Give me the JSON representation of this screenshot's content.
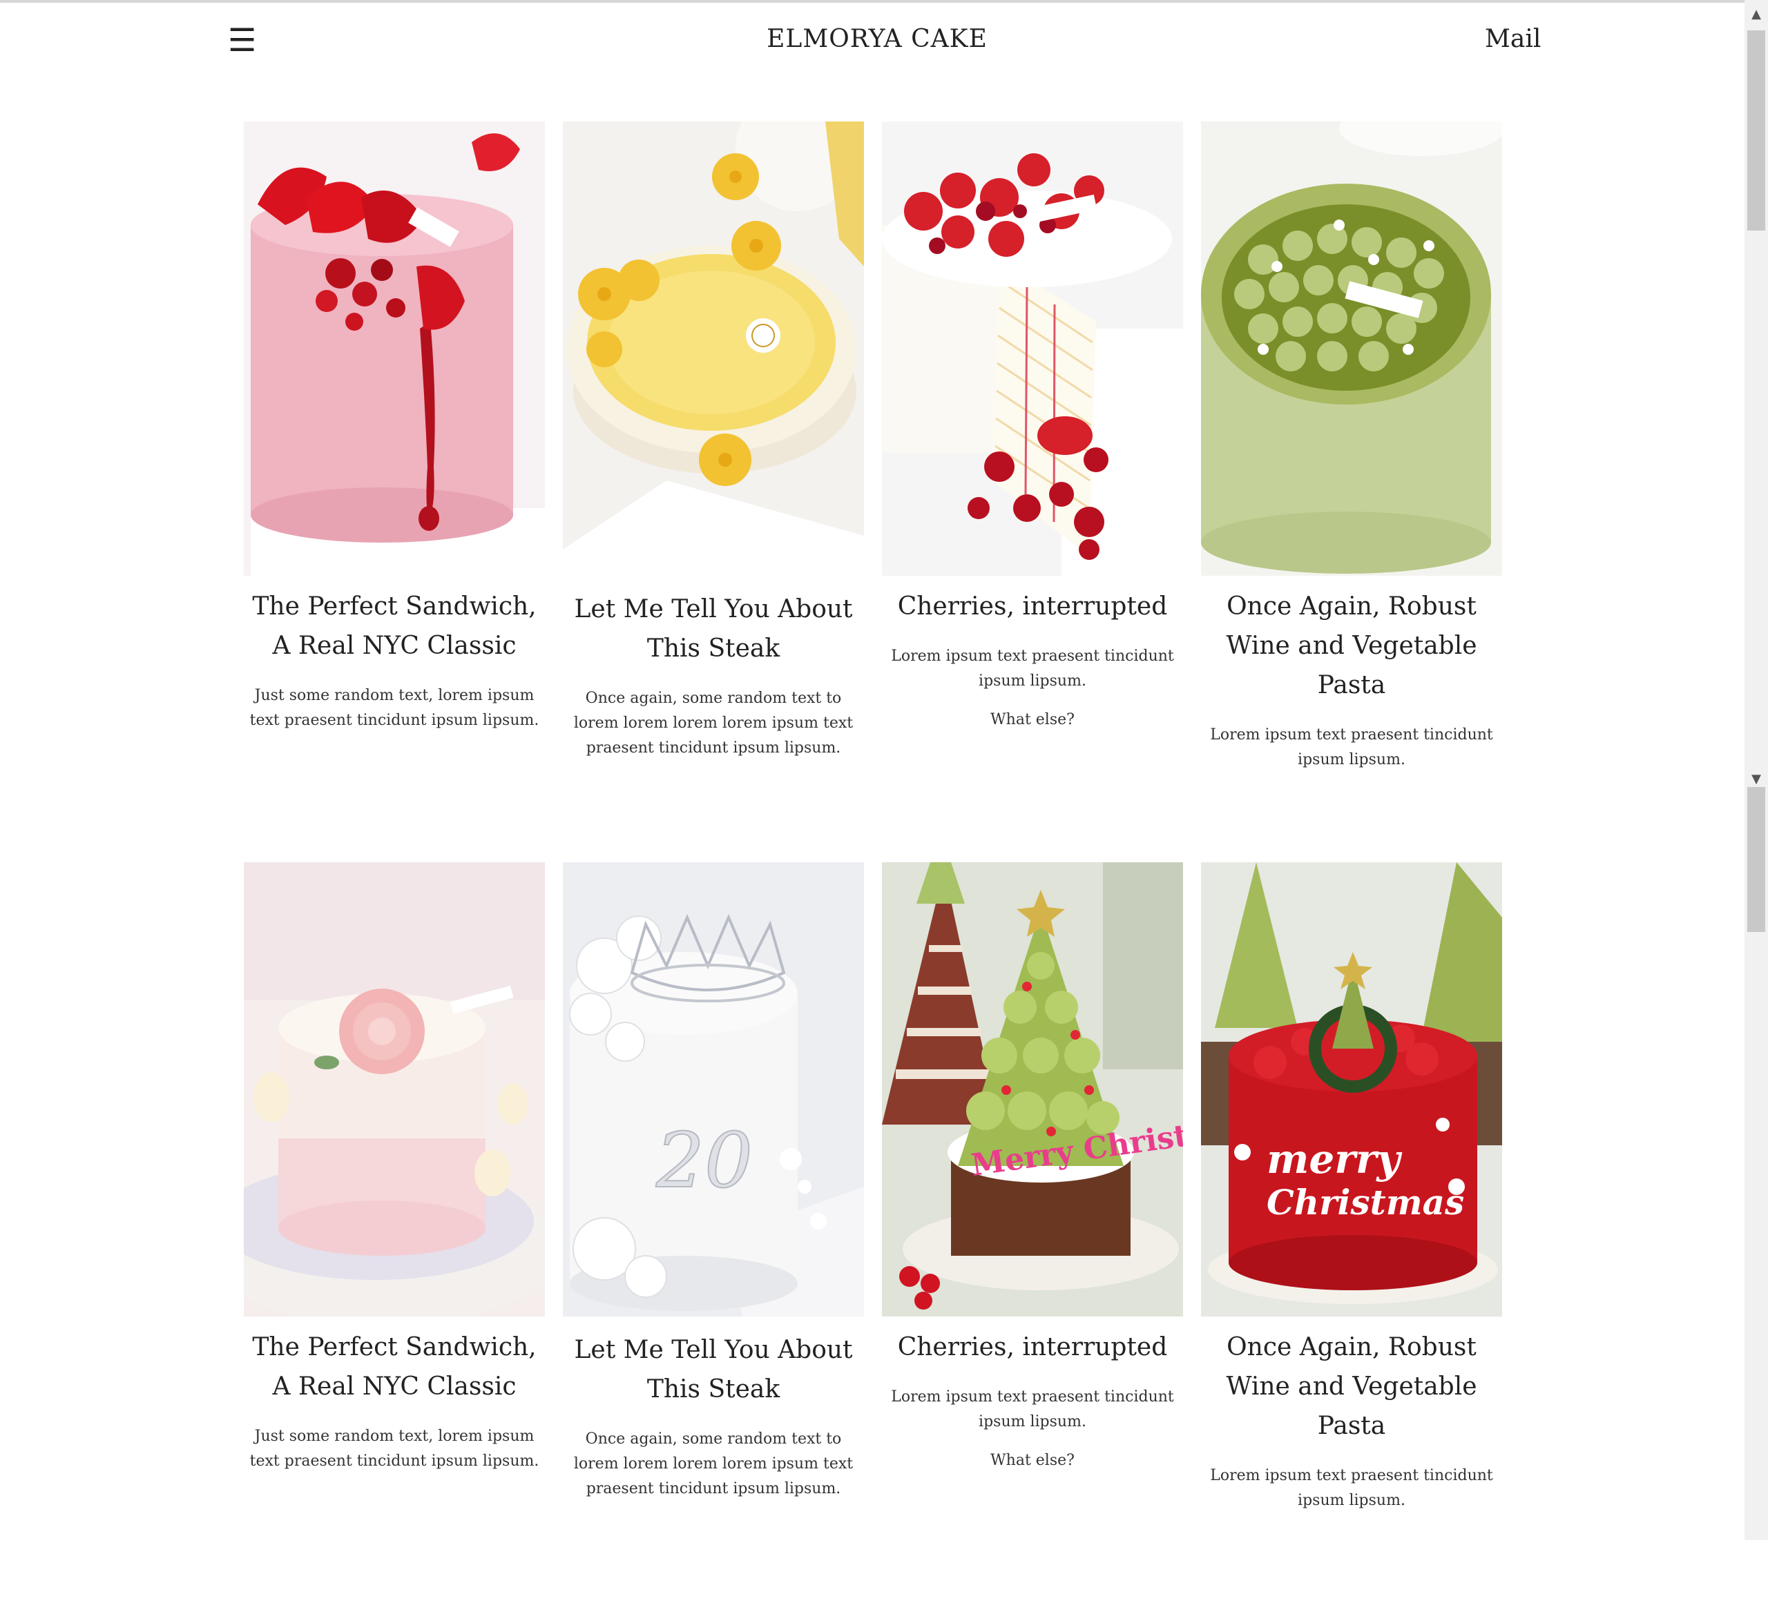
{
  "header": {
    "menu_icon": "☰",
    "site_title": "ELMORYA CAKE",
    "mail_label": "Mail"
  },
  "rows": [
    {
      "cards": [
        {
          "title": "The Perfect Sandwich, A Real NYC Classic",
          "text": "Just some random text, lorem ipsum text praesent tincidunt ipsum lipsum.",
          "extra": "",
          "image": "pink-cake-with-red-drip"
        },
        {
          "title": "Let Me Tell You About This Steak",
          "text": "Once again, some random text to lorem lorem lorem lorem ipsum text praesent tincidunt ipsum lipsum.",
          "extra": "",
          "image": "yellow-flower-cake"
        },
        {
          "title": "Cherries, interrupted",
          "text": "Lorem ipsum text praesent tincidunt ipsum lipsum.",
          "extra": "What else?",
          "image": "strawberry-crepe-cake"
        },
        {
          "title": "Once Again, Robust Wine and Vegetable Pasta",
          "text": "Lorem ipsum text praesent tincidunt ipsum lipsum.",
          "extra": "",
          "image": "green-matcha-cake"
        }
      ]
    },
    {
      "cards": [
        {
          "title": "The Perfect Sandwich, A Real NYC Classic",
          "text": "Just some random text, lorem ipsum text praesent tincidunt ipsum lipsum.",
          "extra": "",
          "image": "pink-flower-cake"
        },
        {
          "title": "Let Me Tell You About This Steak",
          "text": "Once again, some random text to lorem lorem lorem lorem ipsum text praesent tincidunt ipsum lipsum.",
          "extra": "",
          "image": "white-crown-cake"
        },
        {
          "title": "Cherries, interrupted",
          "text": "Lorem ipsum text praesent tincidunt ipsum lipsum.",
          "extra": "What else?",
          "image": "christmas-tree-cake"
        },
        {
          "title": "Once Again, Robust Wine and Vegetable Pasta",
          "text": "Lorem ipsum text praesent tincidunt ipsum lipsum.",
          "extra": "",
          "image": "red-merry-christmas-cake"
        }
      ]
    }
  ],
  "image_text": {
    "cake_text_1": "Merry Christmas",
    "cake_text_2": "merry",
    "cake_text_3": "Christmas",
    "cake_text_4": "20"
  },
  "colors": {
    "text": "#222222",
    "background": "#ffffff",
    "scrollbar_track": "#f1f1f1",
    "scrollbar_thumb": "#c8c8c8"
  }
}
